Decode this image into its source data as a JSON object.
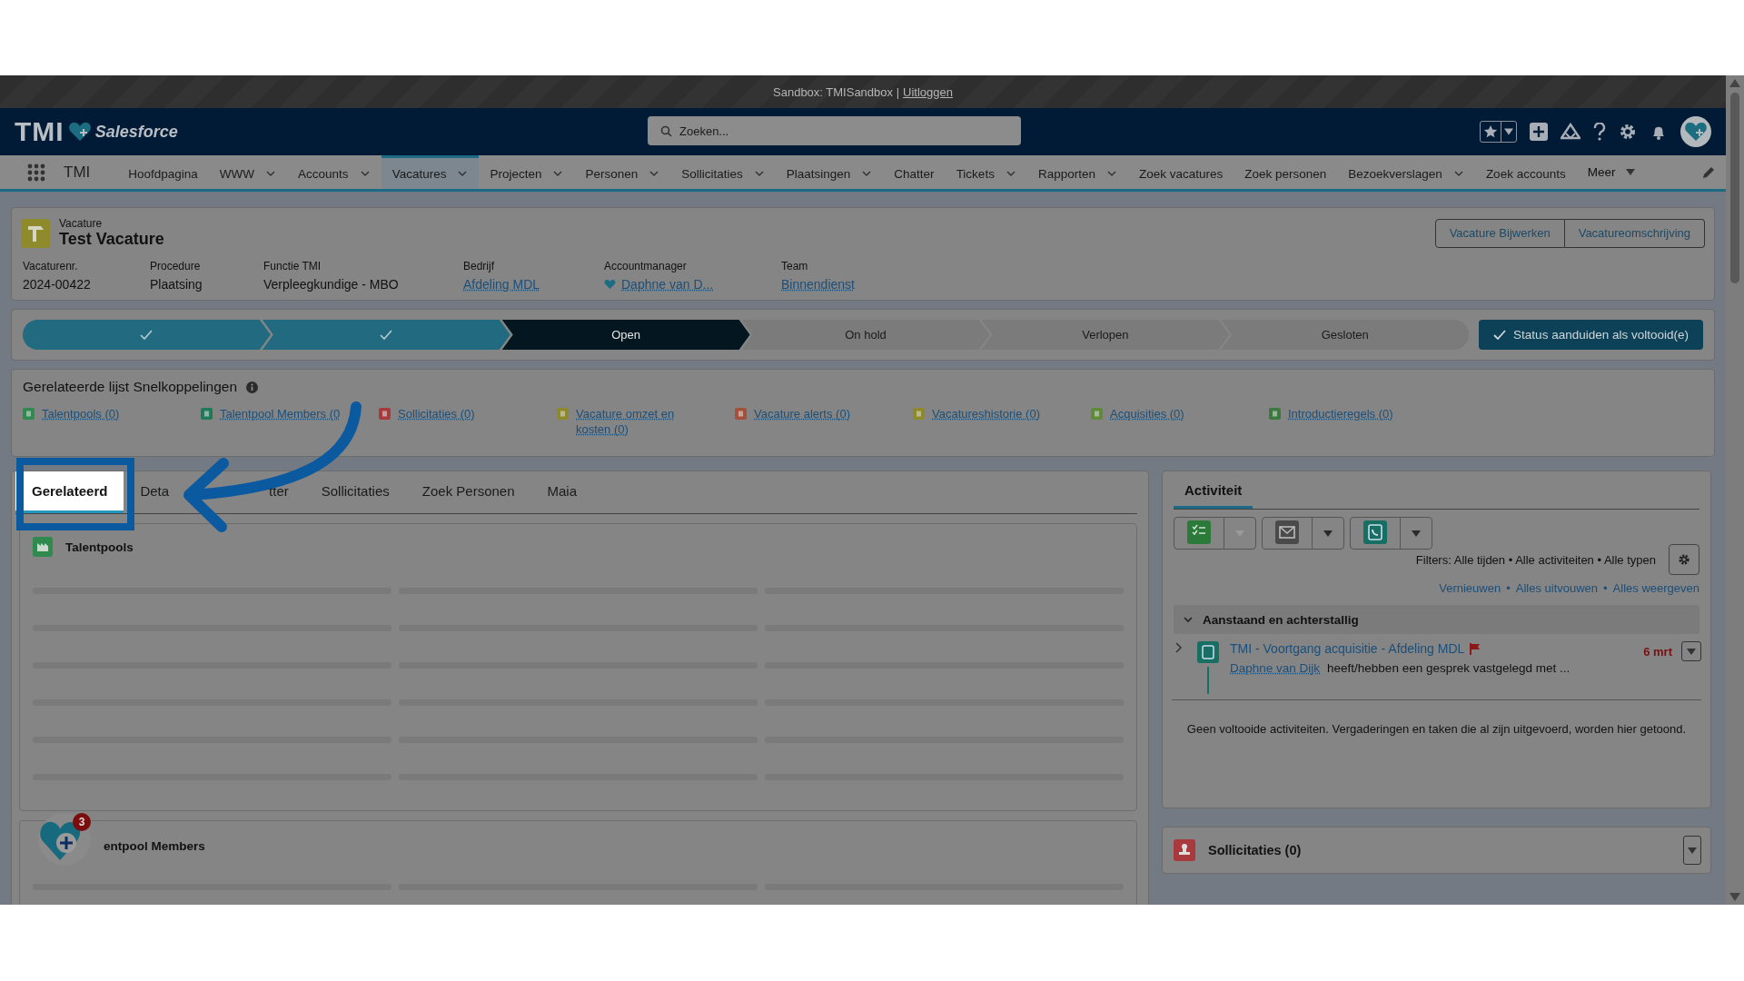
{
  "environment_bar": {
    "text": "Sandbox: TMISandbox |",
    "link": "Uitloggen"
  },
  "header": {
    "logo": "TMI",
    "brand": "Salesforce",
    "search_placeholder": "Zoeken..."
  },
  "nav": {
    "app_name": "TMI",
    "items": [
      {
        "label": "Hoofdpagina",
        "has_menu": false,
        "selected": false
      },
      {
        "label": "WWW",
        "has_menu": true,
        "selected": false
      },
      {
        "label": "Accounts",
        "has_menu": true,
        "selected": false
      },
      {
        "label": "Vacatures",
        "has_menu": true,
        "selected": true
      },
      {
        "label": "Projecten",
        "has_menu": true,
        "selected": false
      },
      {
        "label": "Personen",
        "has_menu": true,
        "selected": false
      },
      {
        "label": "Sollicitaties",
        "has_menu": true,
        "selected": false
      },
      {
        "label": "Plaatsingen",
        "has_menu": true,
        "selected": false
      },
      {
        "label": "Chatter",
        "has_menu": false,
        "selected": false
      },
      {
        "label": "Tickets",
        "has_menu": true,
        "selected": false
      },
      {
        "label": "Rapporten",
        "has_menu": true,
        "selected": false
      },
      {
        "label": "Zoek vacatures",
        "has_menu": false,
        "selected": false
      },
      {
        "label": "Zoek personen",
        "has_menu": false,
        "selected": false
      },
      {
        "label": "Bezoekverslagen",
        "has_menu": true,
        "selected": false
      },
      {
        "label": "Zoek accounts",
        "has_menu": false,
        "selected": false
      }
    ],
    "more": "Meer"
  },
  "record": {
    "object": "Vacature",
    "title": "Test Vacature",
    "actions": [
      "Vacature Bijwerken",
      "Vacatureomschrijving"
    ],
    "fields": [
      {
        "label": "Vacaturenr.",
        "value": "2024-00422",
        "kind": "text"
      },
      {
        "label": "Procedure",
        "value": "Plaatsing",
        "kind": "text"
      },
      {
        "label": "Functie TMI",
        "value": "Verpleegkundige - MBO",
        "kind": "text"
      },
      {
        "label": "Bedrijf",
        "value": "Afdeling MDL",
        "kind": "link"
      },
      {
        "label": "Accountmanager",
        "value": "Daphne van D...",
        "kind": "user"
      },
      {
        "label": "Team",
        "value": "Binnendienst",
        "kind": "link"
      }
    ]
  },
  "path": {
    "stages": [
      {
        "complete": true,
        "current": false
      },
      {
        "complete": true,
        "current": false
      },
      {
        "label": "Open",
        "complete": false,
        "current": true
      },
      {
        "label": "On hold",
        "complete": false,
        "current": false
      },
      {
        "label": "Verlopen",
        "complete": false,
        "current": false
      },
      {
        "label": "Gesloten",
        "complete": false,
        "current": false
      }
    ],
    "button": "Status aanduiden als voltooid(e)"
  },
  "quick_links": {
    "title": "Gerelateerde lijst Snelkoppelingen",
    "links": [
      {
        "label": "Talentpools (0)",
        "color": "#2f8a4e"
      },
      {
        "label": "Talentpool Members (0",
        "color": "#1f7a5a"
      },
      {
        "label": "Sollicitaties (0)",
        "color": "#a83a3e"
      },
      {
        "label": "Vacature omzet en kosten (0)",
        "color": "#8c8a2a"
      },
      {
        "label": "Vacature alerts (0)",
        "color": "#a5503a"
      },
      {
        "label": "Vacatureshistorie (0)",
        "color": "#8c8a2a"
      },
      {
        "label": "Acquisities (0)",
        "color": "#5f8a3a"
      },
      {
        "label": "Introductieregels (0)",
        "color": "#3a7a3e"
      }
    ]
  },
  "main_tabs": [
    {
      "label": "Gerelateerd",
      "selected": true,
      "highlighted": true
    },
    {
      "label": "Deta",
      "selected": false,
      "highlighted": false
    },
    {
      "label": "tter",
      "selected": false,
      "highlighted": false
    },
    {
      "label": "Sollicitaties",
      "selected": false,
      "highlighted": false
    },
    {
      "label": "Zoek Personen",
      "selected": false,
      "highlighted": false
    },
    {
      "label": "Maia",
      "selected": false,
      "highlighted": false
    }
  ],
  "related_lists": [
    {
      "title": "Talentpools",
      "loading": true
    },
    {
      "title": "entpool Members",
      "loading": true
    }
  ],
  "activity": {
    "title": "Activiteit",
    "actions": [
      {
        "kind": "task",
        "menu_disabled": true
      },
      {
        "kind": "email",
        "menu_disabled": false
      },
      {
        "kind": "call",
        "menu_disabled": false
      }
    ],
    "filters": "Filters: Alle tijden • Alle activiteiten • Alle typen",
    "links": [
      "Vernieuwen",
      "Alles uitvouwen",
      "Alles weergeven"
    ],
    "link_separator": "•",
    "section": {
      "title": "Aanstaand en achterstallig",
      "expanded": true,
      "items": [
        {
          "title": "TMI - Voortgang acquisitie - Afdeling MDL",
          "flagged": true,
          "date": "6 mrt",
          "overdue": true,
          "person": "Daphne van Dijk",
          "summary": "heeft/hebben een gesprek vastgelegd met ...",
          "expanded": false
        }
      ]
    },
    "empty_message": "Geen voltooide activiteiten. Vergaderingen en taken die al zijn uitgevoerd, worden hier getoond."
  },
  "side_cards": [
    {
      "title": "Sollicitaties (0)"
    }
  ],
  "notification_count": "3"
}
